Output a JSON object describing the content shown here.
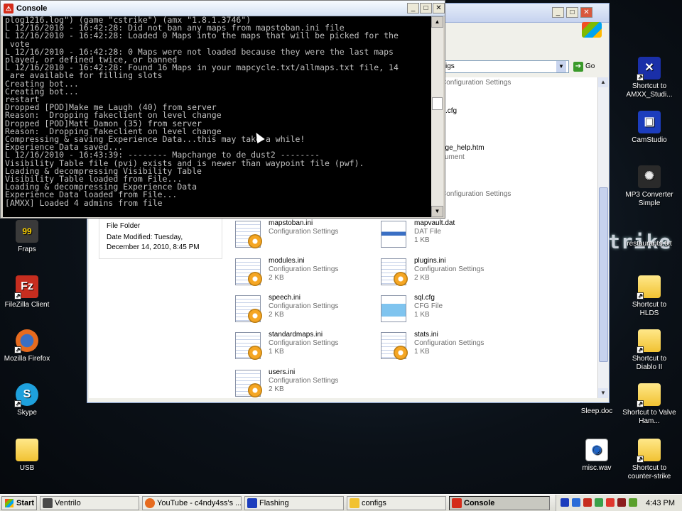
{
  "desktop": {
    "icons_left": [
      {
        "label": "Fraps",
        "icon": "fraps-icon",
        "glyph": "99",
        "color": "#3a3a3a"
      },
      {
        "label": "FileZilla Client",
        "icon": "filezilla-icon",
        "glyph": "Fz",
        "color": "#c62d1f"
      },
      {
        "label": "Mozilla Firefox",
        "icon": "firefox-icon",
        "glyph": "🦊",
        "color": "#e66b1f"
      },
      {
        "label": "Skype",
        "icon": "skype-icon",
        "glyph": "S",
        "color": "#1ea0dc"
      },
      {
        "label": "USB",
        "icon": "folder-icon",
        "glyph": "",
        "color": ""
      }
    ],
    "icons_right": [
      {
        "label": "Shortcut to AMXX_Studi...",
        "icon": "amxx-studio-icon",
        "glyph": "✕",
        "color": "#1a2fa8"
      },
      {
        "label": "CamStudio",
        "icon": "camstudio-icon",
        "glyph": "▣",
        "color": "#1c3dbd"
      },
      {
        "label": "MP3 Converter Simple",
        "icon": "mp3-converter-icon",
        "glyph": "✺",
        "color": "#2a2a2a"
      },
      {
        "label": "restaurants.txt",
        "icon": "text-file-icon",
        "glyph": "",
        "color": ""
      },
      {
        "label": "Shortcut to HLDS",
        "icon": "folder-shortcut-icon",
        "glyph": "",
        "color": ""
      },
      {
        "label": "Shortcut to Diablo II",
        "icon": "folder-shortcut-icon",
        "glyph": "",
        "color": ""
      },
      {
        "label": "Shortcut to Valve Ham...",
        "icon": "folder-shortcut-icon",
        "glyph": "",
        "color": ""
      },
      {
        "label": "Shortcut to counter-strike",
        "icon": "folder-shortcut-icon",
        "glyph": "",
        "color": ""
      }
    ],
    "loose_icons": [
      {
        "label": "Sleep.doc",
        "icon": "doc-file-icon"
      },
      {
        "label": "misc.wav",
        "icon": "wav-file-icon"
      }
    ],
    "watermark": "trike"
  },
  "explorer": {
    "address_text": "igs",
    "go_label": "Go",
    "partial_top": [
      {
        "text": "Configuration Settings",
        "gray": true
      },
      {
        "text": ".cfg",
        "gray": false
      },
      {
        "text": "age_help.htm",
        "gray": false
      },
      {
        "text": "cument",
        "gray": true
      },
      {
        "text": "Configuration Settings",
        "gray": true
      }
    ],
    "detail": {
      "type": "File Folder",
      "modified_label": "Date Modified: Tuesday,",
      "modified_date": "December 14, 2010, 8:45 PM"
    },
    "files": [
      {
        "name": "mapstoban.ini",
        "type": "Configuration Settings",
        "size": "",
        "kind": "ini"
      },
      {
        "name": "mapvault.dat",
        "type": "DAT File",
        "size": "1 KB",
        "kind": "dat"
      },
      {
        "name": "modules.ini",
        "type": "Configuration Settings",
        "size": "2 KB",
        "kind": "ini"
      },
      {
        "name": "plugins.ini",
        "type": "Configuration Settings",
        "size": "2 KB",
        "kind": "ini"
      },
      {
        "name": "speech.ini",
        "type": "Configuration Settings",
        "size": "2 KB",
        "kind": "ini"
      },
      {
        "name": "sql.cfg",
        "type": "CFG File",
        "size": "1 KB",
        "kind": "cfg"
      },
      {
        "name": "standardmaps.ini",
        "type": "Configuration Settings",
        "size": "1 KB",
        "kind": "ini"
      },
      {
        "name": "stats.ini",
        "type": "Configuration Settings",
        "size": "1 KB",
        "kind": "ini"
      },
      {
        "name": "users.ini",
        "type": "Configuration Settings",
        "size": "2 KB",
        "kind": "ini"
      }
    ]
  },
  "console": {
    "title": "Console",
    "lines": [
      "plog1216.log\") (game \"cstrike\") (amx \"1.8.1.3746\")",
      "L 12/16/2010 - 16:42:28: Did not ban any maps from mapstoban.ini file",
      "L 12/16/2010 - 16:42:28: Loaded 0 Maps into the maps that will be picked for the",
      " vote",
      "L 12/16/2010 - 16:42:28: 0 Maps were not loaded because they were the last maps",
      "played, or defined twice, or banned",
      "L 12/16/2010 - 16:42:28: Found 16 Maps in your mapcycle.txt/allmaps.txt file, 14",
      " are available for filling slots",
      "Creating bot...",
      "Creating bot...",
      "restart",
      "Dropped [POD]Make me Laugh (40) from server",
      "Reason:  Dropping fakeclient on level change",
      "Dropped [POD]Matt_Damon (35) from server",
      "Reason:  Dropping fakeclient on level change",
      "Compressing & saving Experience Data...this may take a while!",
      "Experience Data saved...",
      "L 12/16/2010 - 16:43:39: -------- Mapchange to de_dust2 --------",
      "Visibility Table file (pvi) exists and is newer than waypoint file (pwf).",
      "Loading & decompressing Visibility Table",
      "Visibility Table loaded from File...",
      "Loading & decompressing Experience Data",
      "Experience Data loaded from File...",
      "[AMXX] Loaded 4 admins from file"
    ]
  },
  "taskbar": {
    "start_label": "Start",
    "buttons": [
      {
        "label": "Ventrilo",
        "icon": "ventrilo-icon",
        "color": "#4a4a4a",
        "active": false
      },
      {
        "label": "YouTube - c4ndy4ss's ...",
        "icon": "firefox-icon",
        "color": "#e66b1f",
        "active": false
      },
      {
        "label": "Flashing",
        "icon": "flashing-app-icon",
        "color": "#1c3dbd",
        "active": false
      },
      {
        "label": "configs",
        "icon": "folder-icon",
        "color": "#f1c232",
        "active": false
      },
      {
        "label": "Console",
        "icon": "console-app-icon",
        "color": "#d42c1a",
        "active": true
      }
    ],
    "clock": "4:43 PM"
  }
}
